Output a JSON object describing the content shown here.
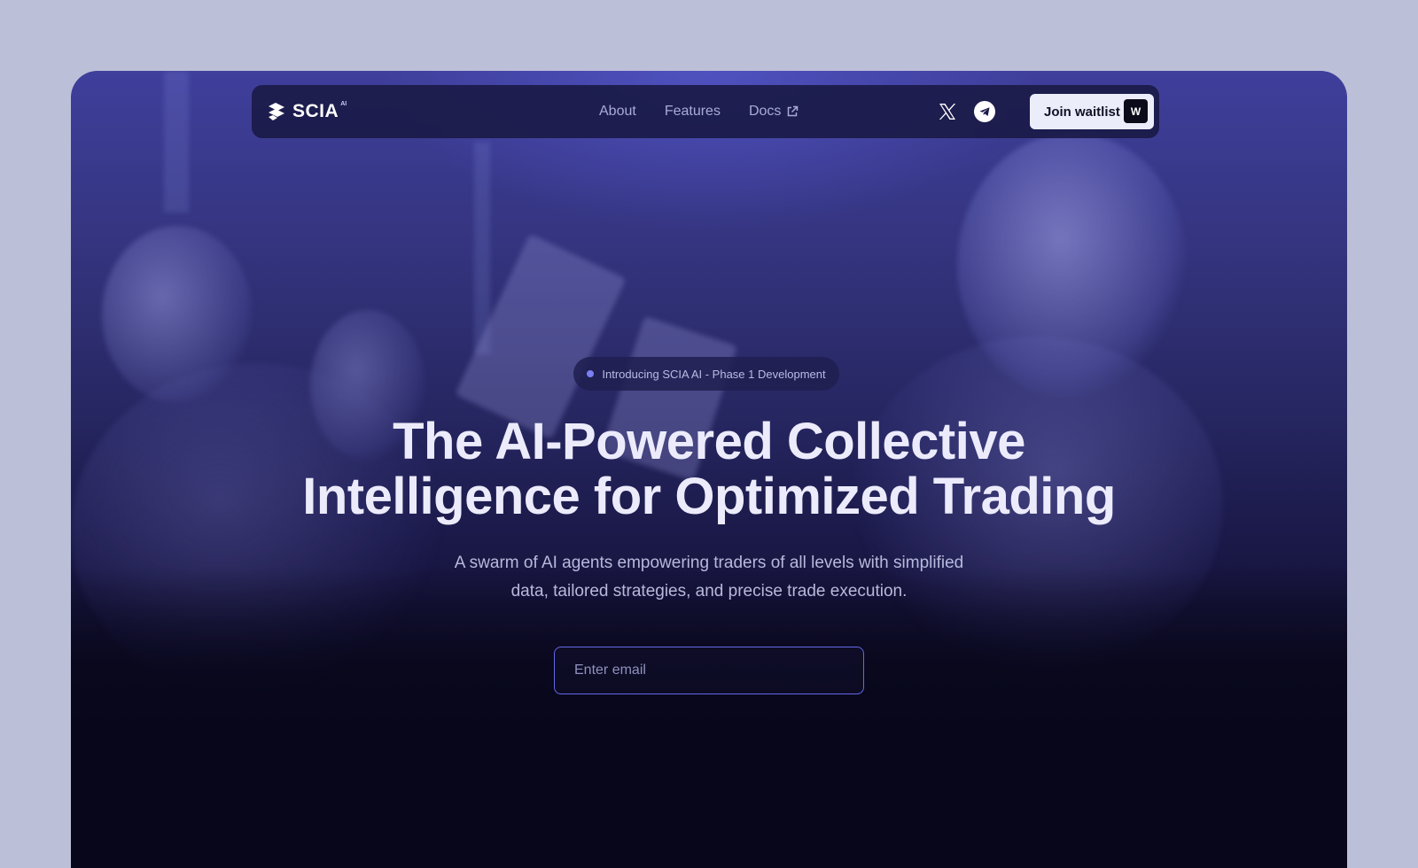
{
  "nav": {
    "logo_text": "SCIA",
    "logo_sup": "AI",
    "links": [
      {
        "label": "About"
      },
      {
        "label": "Features"
      },
      {
        "label": "Docs",
        "icon": "external-link-icon"
      }
    ],
    "social": [
      "x-icon",
      "telegram-icon"
    ],
    "cta_label": "Join waitlist",
    "cta_shortcut": "W"
  },
  "hero": {
    "badge_text": "Introducing SCIA AI - Phase 1 Development",
    "headline_line1": "The AI-Powered Collective",
    "headline_line2": "Intelligence for Optimized Trading",
    "subtext_line1": "A swarm of AI agents empowering traders of all levels with simplified",
    "subtext_line2": "data, tailored strategies, and precise trade execution.",
    "email_placeholder": "Enter email",
    "email_value": ""
  },
  "colors": {
    "page_bg": "#bcbfd8",
    "accent": "#6468e6",
    "headline": "#ecebfb",
    "cta_bg": "#ecedfb"
  }
}
